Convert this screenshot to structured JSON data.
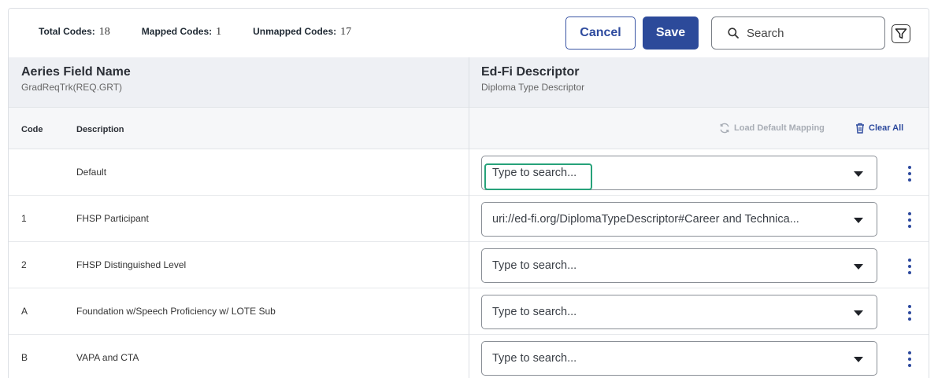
{
  "stats": {
    "total_label": "Total Codes:",
    "total_value": "18",
    "mapped_label": "Mapped Codes:",
    "mapped_value": "1",
    "unmapped_label": "Unmapped Codes:",
    "unmapped_value": "17"
  },
  "toolbar": {
    "cancel_label": "Cancel",
    "save_label": "Save",
    "search_placeholder": "Search",
    "search_icon": "search-icon",
    "filter_icon": "filter-icon"
  },
  "columns": {
    "left_title": "Aeries Field Name",
    "left_sub": "GradReqTrk(REQ.GRT)",
    "right_title": "Ed-Fi Descriptor",
    "right_sub": "Diploma Type Descriptor"
  },
  "table_header": {
    "code": "Code",
    "description": "Description",
    "load_default": "Load Default Mapping",
    "clear_all": "Clear All"
  },
  "rows": [
    {
      "code": "",
      "description": "Default",
      "value": "Type to search..."
    },
    {
      "code": "1",
      "description": "FHSP Participant",
      "value": "uri://ed-fi.org/DiplomaTypeDescriptor#Career and Technica..."
    },
    {
      "code": "2",
      "description": "FHSP Distinguished Level",
      "value": "Type to search..."
    },
    {
      "code": "A",
      "description": "Foundation w/Speech Proficiency w/ LOTE Sub",
      "value": "Type to search..."
    },
    {
      "code": "B",
      "description": "VAPA and CTA",
      "value": "Type to search..."
    }
  ],
  "colors": {
    "accent": "#2c4a9a",
    "focus": "#27a27a",
    "header_bg": "#eef0f4"
  }
}
